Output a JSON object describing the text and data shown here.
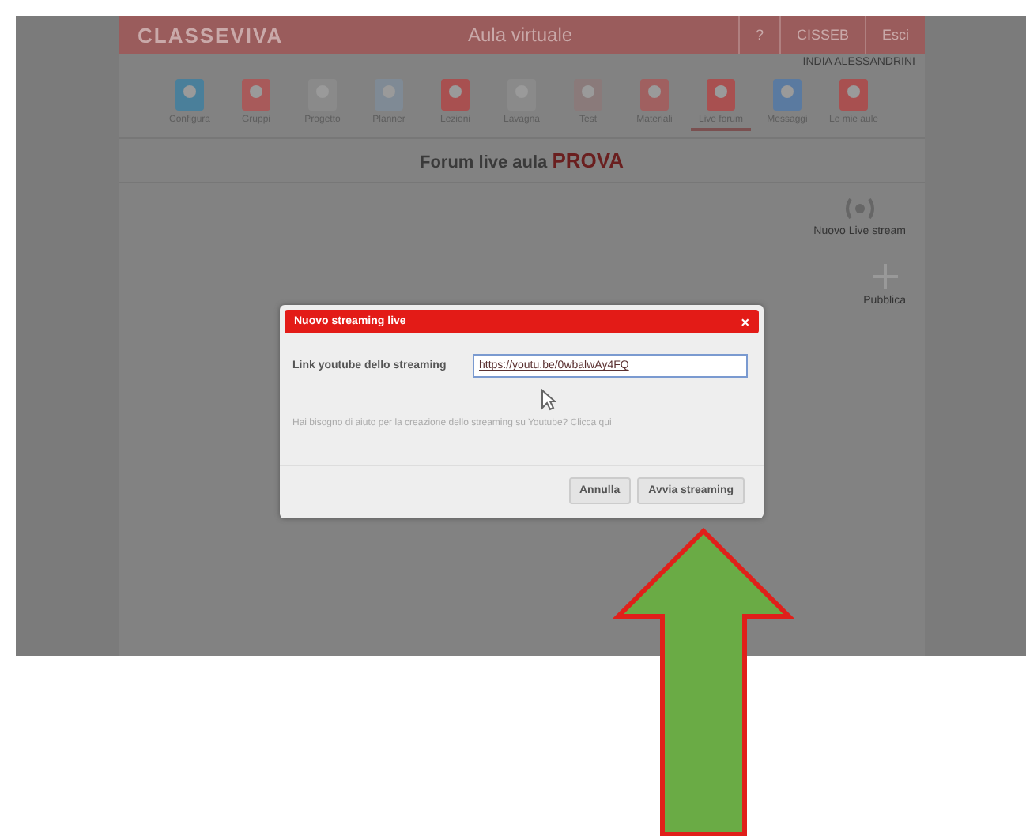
{
  "header": {
    "logo": "CLASSEVIVA",
    "title": "Aula virtuale",
    "help": "?",
    "user_button": "CISSEB",
    "exit": "Esci",
    "user_name": "INDIA ALESSANDRINI"
  },
  "toolbar": [
    {
      "label": "Configura",
      "selected": false
    },
    {
      "label": "Gruppi",
      "selected": false
    },
    {
      "label": "Progetto",
      "selected": false
    },
    {
      "label": "Planner",
      "selected": false
    },
    {
      "label": "Lezioni",
      "selected": false
    },
    {
      "label": "Lavagna",
      "selected": false
    },
    {
      "label": "Test",
      "selected": false
    },
    {
      "label": "Materiali",
      "selected": false
    },
    {
      "label": "Live forum",
      "selected": true
    },
    {
      "label": "Messaggi",
      "selected": false
    },
    {
      "label": "Le mie aule",
      "selected": false
    }
  ],
  "page_title": {
    "text": "Forum live aula",
    "highlight": "PROVA"
  },
  "side_actions": [
    {
      "label": "Nuovo Live stream",
      "kind": "stream"
    },
    {
      "label": "Pubblica",
      "kind": "plus"
    }
  ],
  "dialog": {
    "title": "Nuovo streaming live",
    "close": "×",
    "field_label": "Link youtube dello streaming",
    "field_value": "https://youtu.be/0wbalwAy4FQ",
    "help_text": "Hai bisogno di aiuto per la creazione dello streaming su Youtube? Clicca qui",
    "buttons": [
      "Annulla",
      "Avvia streaming"
    ]
  }
}
